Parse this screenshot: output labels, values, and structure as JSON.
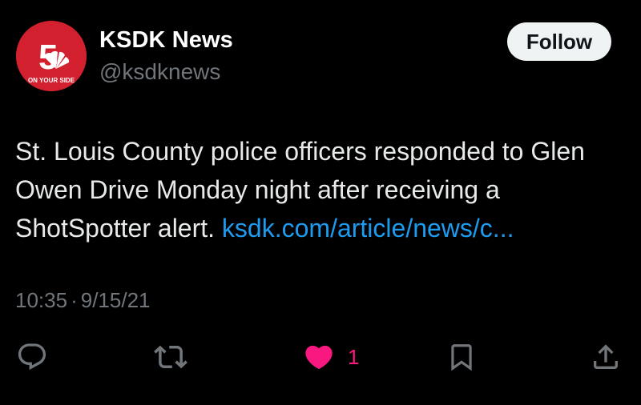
{
  "author": {
    "name": "KSDK News",
    "handle": "@ksdknews",
    "avatar": {
      "number": "5",
      "tagline": "ON YOUR SIDE",
      "color": "#d3202f"
    }
  },
  "follow_label": "Follow",
  "tweet": {
    "text": "St. Louis County police officers responded to Glen Owen Drive Monday night after receiving a ShotSpotter alert. ",
    "link": "ksdk.com/article/news/c...",
    "time": "10:35",
    "separator": "·",
    "date": "9/15/21"
  },
  "actions": {
    "reply_icon": "reply-icon",
    "retweet_icon": "retweet-icon",
    "like_icon": "heart-icon",
    "like_count": "1",
    "bookmark_icon": "bookmark-icon",
    "share_icon": "share-icon"
  },
  "colors": {
    "background": "#000000",
    "text": "#e7e9ea",
    "muted": "#71767b",
    "link": "#1d9bf0",
    "like": "#f91880",
    "icon": "#71767b"
  }
}
